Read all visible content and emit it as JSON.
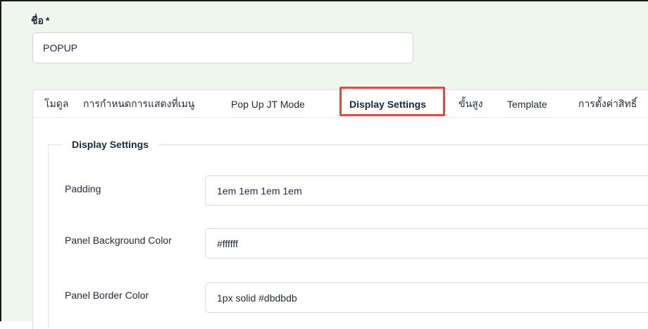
{
  "form": {
    "name_label": "ชื่อ",
    "required_mark": "*",
    "name_value": "POPUP"
  },
  "tabs": [
    {
      "label": "โมดูล"
    },
    {
      "label": "การกำหนดการแสดงที่เมนู"
    },
    {
      "label": "Pop Up JT Mode"
    },
    {
      "label": "Display Settings"
    },
    {
      "label": "ขั้นสูง"
    },
    {
      "label": "Template"
    },
    {
      "label": "การตั้งค่าสิทธิ์"
    }
  ],
  "active_tab": "Display Settings",
  "display_settings": {
    "legend": "Display Settings",
    "fields": [
      {
        "label": "Padding",
        "value": "1em 1em 1em 1em"
      },
      {
        "label": "Panel Background Color",
        "value": "#ffffff"
      },
      {
        "label": "Panel Border Color",
        "value": "1px solid #dbdbdb"
      }
    ]
  },
  "colors": {
    "page_background": "#eef6ee",
    "highlight_border": "#e2473b",
    "active_tab_underline": "#2b5a8a"
  }
}
